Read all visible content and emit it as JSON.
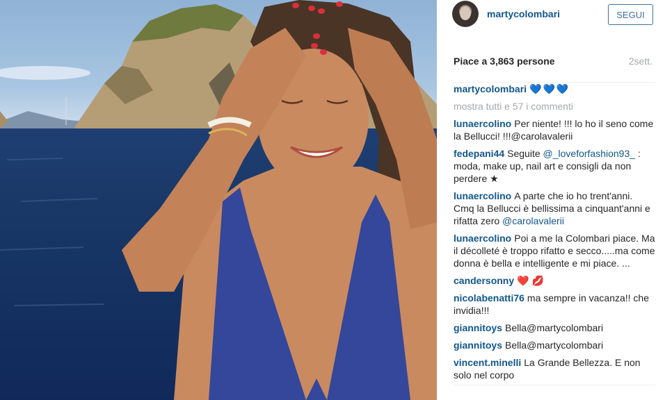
{
  "post": {
    "username": "martycolombari",
    "follow_label": "SEGUI",
    "likes": "Piace a 3,863 persone",
    "time": "2sett.",
    "caption": {
      "author": "martycolombari",
      "text": "💙💙💙"
    },
    "load_more": "mostra tutti e 57 i commenti"
  },
  "comments": [
    {
      "author": "lunaercolino",
      "text": "Per niente! !!! lo ho il seno come la Bellucci! !!!@carolavalerii",
      "mention": ""
    },
    {
      "author": "fedepani44",
      "text": "Seguite ",
      "mention": "@_loveforfashion93_",
      "after": " : moda, make up, nail art e consigli da non perdere ★"
    },
    {
      "author": "lunaercolino",
      "text": "A parte che io ho trent'anni. Cmq la Bellucci è bellissima a cinquant'anni e rifatta zero ",
      "mention": "@carolavalerii"
    },
    {
      "author": "lunaercolino",
      "text": "Poi a me la Colombari piace. Ma il décolleté è troppo rifatto e secco.....ma come donna è bella e intelligente e mi piace. ...",
      "mention": ""
    },
    {
      "author": "candersonny",
      "text": "❤️ 💋",
      "mention": ""
    },
    {
      "author": "nicolabenatti76",
      "text": "ma sempre in vacanza!! che invidia!!!",
      "mention": ""
    },
    {
      "author": "giannitoys",
      "text": "Bella@martycolombari",
      "mention": ""
    },
    {
      "author": "giannitoys",
      "text": "Bella@martycolombari",
      "mention": ""
    },
    {
      "author": "vincent.minelli",
      "text": "La Grande Bellezza. E non solo nel corpo",
      "mention": ""
    }
  ],
  "colors": {
    "link": "#125688",
    "follow": "#3f729b",
    "muted": "#a5a7aa"
  }
}
